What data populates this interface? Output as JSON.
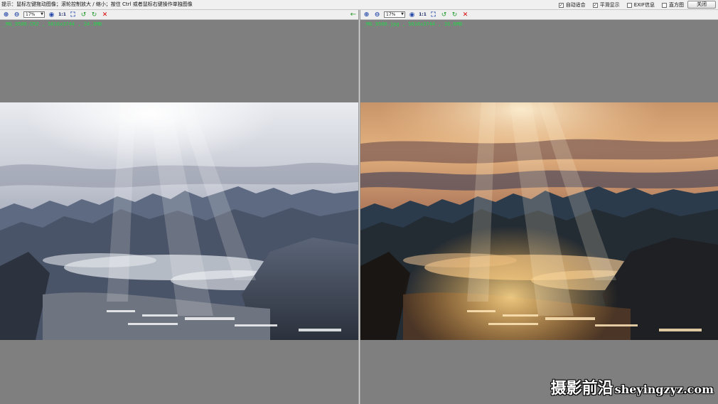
{
  "hint": "提示：鼠标左键拖动图像；滚轮控制放大 / 缩小；按住 Ctrl 或者鼠标右键操作单独图像",
  "options": [
    {
      "label": "自动适合",
      "checked": true
    },
    {
      "label": "平滑显示",
      "checked": true
    },
    {
      "label": "EXIF信息",
      "checked": false
    },
    {
      "label": "直方图",
      "checked": false
    }
  ],
  "close_label": "关闭",
  "panes": {
    "left": {
      "zoom": "17%",
      "actual_size_label": "1:1",
      "file_info": "_MG_9500.CR2 , 5616x3744 , 24.3MB"
    },
    "right": {
      "zoom": "17%",
      "actual_size_label": "1:1",
      "file_info": "_MG_9500.jpg , 5616x3744 , 16.6MB"
    }
  },
  "watermark": {
    "cn": "摄影前沿",
    "en": "sheyingzyz.com"
  },
  "colors": {
    "file_info": "#27d34a",
    "toolbar_bg": "#efefef",
    "canvas_bg": "#7f7f7f"
  }
}
